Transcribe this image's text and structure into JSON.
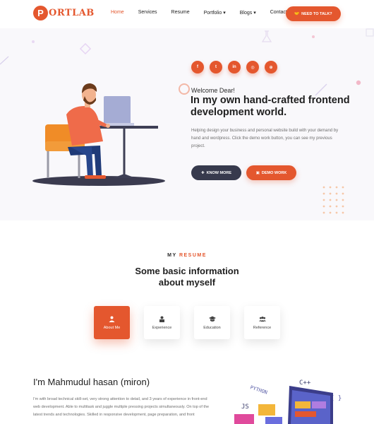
{
  "header": {
    "logo_letter": "P",
    "logo_text": "ORTLAB",
    "nav": [
      {
        "label": "Home",
        "active": true
      },
      {
        "label": "Services",
        "active": false
      },
      {
        "label": "Resume",
        "active": false
      },
      {
        "label": "Portfolio ▾",
        "active": false
      },
      {
        "label": "Blogs ▾",
        "active": false
      },
      {
        "label": "Contact",
        "active": false
      }
    ],
    "cta_label": "NEED TO TALK?",
    "cta_icon": "handshake-icon"
  },
  "hero": {
    "social": [
      {
        "icon": "facebook-icon",
        "glyph": "f"
      },
      {
        "icon": "twitter-icon",
        "glyph": "t"
      },
      {
        "icon": "linkedin-icon",
        "glyph": "in"
      },
      {
        "icon": "instagram-icon",
        "glyph": "◎"
      },
      {
        "icon": "dribbble-icon",
        "glyph": "⊕"
      }
    ],
    "welcome": "Welcome Dear!",
    "headline": "In my own hand-crafted frontend development world.",
    "description": "Helping design your business and personal website build with your demand by hand and wordpress. Click the demo work button, you can see my previous project.",
    "btn_know": "KNOW MORE",
    "btn_demo": "DEMO WORK"
  },
  "resume": {
    "sub_prefix": "MY",
    "sub_accent": "RESUME",
    "title_line1": "Some basic information",
    "title_line2": "about myself",
    "tabs": [
      {
        "label": "About Me",
        "icon": "person-icon",
        "active": true
      },
      {
        "label": "Experience",
        "icon": "briefcase-user-icon",
        "active": false
      },
      {
        "label": "Education",
        "icon": "graduation-icon",
        "active": false
      },
      {
        "label": "Reference",
        "icon": "group-icon",
        "active": false
      }
    ]
  },
  "about": {
    "name": "I'm Mahmudul hasan (miron)",
    "text": "I'm with broad technical skill-set, very strong attention to detail, and 3 years of experience in front-end web development. Able to multitask and juggle multiple pressing projects simultaneously. On top of the latest trends and technologies. Skilled in responsive development, page preparation, and front"
  },
  "colors": {
    "accent": "#e4572e",
    "dark_button": "#373a4d",
    "hero_bg": "#f9f8fb"
  }
}
